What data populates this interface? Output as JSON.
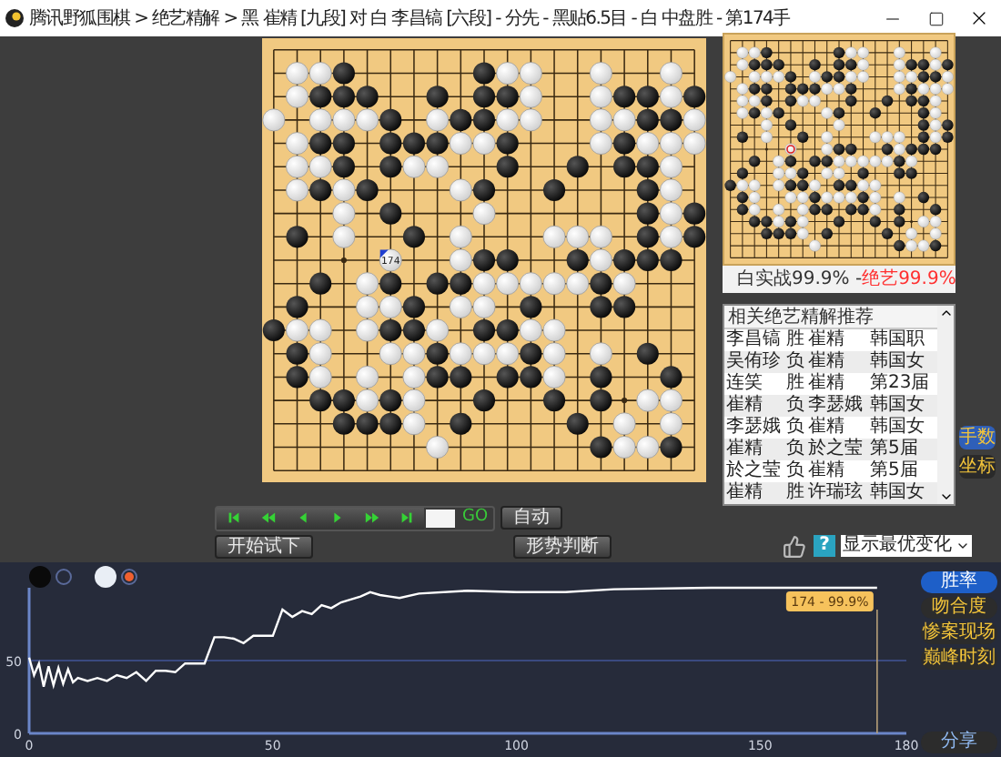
{
  "window": {
    "title": "腾讯野狐围棋 > 绝艺精解 > 黑 崔精 [九段] 对 白 李昌镐 [六段] - 分先 - 黑贴6.5目 - 白 中盘胜 - 第174手"
  },
  "board": {
    "last_move_label": "174",
    "rows": [
      [
        {
          "kind": "none"
        },
        {
          "kind": "none"
        },
        {
          "kind": "none"
        },
        {
          "kind": "none"
        },
        {
          "kind": "none"
        },
        {
          "kind": "none"
        },
        {
          "kind": "none"
        },
        {
          "kind": "none"
        },
        {
          "kind": "none"
        },
        {
          "kind": "none"
        },
        {
          "kind": "none"
        },
        {
          "kind": "none"
        },
        {
          "kind": "none"
        },
        {
          "kind": "none"
        },
        {
          "kind": "none"
        },
        {
          "kind": "none"
        },
        {
          "kind": "none"
        },
        {
          "kind": "none"
        },
        {
          "kind": "none"
        }
      ],
      [
        {
          "kind": "none"
        },
        {
          "kind": "white"
        },
        {
          "kind": "white"
        },
        {
          "kind": "black"
        },
        {
          "kind": "none"
        },
        {
          "kind": "none"
        },
        {
          "kind": "none"
        },
        {
          "kind": "none"
        },
        {
          "kind": "none"
        },
        {
          "kind": "black"
        },
        {
          "kind": "white"
        },
        {
          "kind": "white"
        },
        {
          "kind": "none"
        },
        {
          "kind": "none"
        },
        {
          "kind": "white"
        },
        {
          "kind": "none"
        },
        {
          "kind": "none"
        },
        {
          "kind": "white"
        },
        {
          "kind": "none"
        }
      ],
      [
        {
          "kind": "none"
        },
        {
          "kind": "white"
        },
        {
          "kind": "black"
        },
        {
          "kind": "black"
        },
        {
          "kind": "black"
        },
        {
          "kind": "none"
        },
        {
          "kind": "none"
        },
        {
          "kind": "black"
        },
        {
          "kind": "none"
        },
        {
          "kind": "black"
        },
        {
          "kind": "black"
        },
        {
          "kind": "white"
        },
        {
          "kind": "none"
        },
        {
          "kind": "none"
        },
        {
          "kind": "white"
        },
        {
          "kind": "black"
        },
        {
          "kind": "black"
        },
        {
          "kind": "white"
        },
        {
          "kind": "black"
        }
      ],
      [
        {
          "kind": "white"
        },
        {
          "kind": "none"
        },
        {
          "kind": "white"
        },
        {
          "kind": "white"
        },
        {
          "kind": "white"
        },
        {
          "kind": "black"
        },
        {
          "kind": "none"
        },
        {
          "kind": "white"
        },
        {
          "kind": "black"
        },
        {
          "kind": "black"
        },
        {
          "kind": "white"
        },
        {
          "kind": "white"
        },
        {
          "kind": "none"
        },
        {
          "kind": "none"
        },
        {
          "kind": "white"
        },
        {
          "kind": "white"
        },
        {
          "kind": "black"
        },
        {
          "kind": "black"
        },
        {
          "kind": "white"
        }
      ],
      [
        {
          "kind": "none"
        },
        {
          "kind": "white"
        },
        {
          "kind": "black"
        },
        {
          "kind": "black"
        },
        {
          "kind": "none"
        },
        {
          "kind": "black"
        },
        {
          "kind": "black"
        },
        {
          "kind": "black"
        },
        {
          "kind": "white"
        },
        {
          "kind": "white"
        },
        {
          "kind": "black"
        },
        {
          "kind": "none"
        },
        {
          "kind": "none"
        },
        {
          "kind": "none"
        },
        {
          "kind": "white"
        },
        {
          "kind": "black"
        },
        {
          "kind": "white"
        },
        {
          "kind": "white"
        },
        {
          "kind": "white"
        }
      ],
      [
        {
          "kind": "none"
        },
        {
          "kind": "white"
        },
        {
          "kind": "white"
        },
        {
          "kind": "black"
        },
        {
          "kind": "none"
        },
        {
          "kind": "black"
        },
        {
          "kind": "white"
        },
        {
          "kind": "white"
        },
        {
          "kind": "none"
        },
        {
          "kind": "none"
        },
        {
          "kind": "black"
        },
        {
          "kind": "none"
        },
        {
          "kind": "none"
        },
        {
          "kind": "black"
        },
        {
          "kind": "none"
        },
        {
          "kind": "black"
        },
        {
          "kind": "black"
        },
        {
          "kind": "white"
        },
        {
          "kind": "none"
        }
      ],
      [
        {
          "kind": "none"
        },
        {
          "kind": "white"
        },
        {
          "kind": "black"
        },
        {
          "kind": "white"
        },
        {
          "kind": "black"
        },
        {
          "kind": "none"
        },
        {
          "kind": "none"
        },
        {
          "kind": "none"
        },
        {
          "kind": "white"
        },
        {
          "kind": "black"
        },
        {
          "kind": "none"
        },
        {
          "kind": "none"
        },
        {
          "kind": "black"
        },
        {
          "kind": "none"
        },
        {
          "kind": "none"
        },
        {
          "kind": "none"
        },
        {
          "kind": "black"
        },
        {
          "kind": "white"
        },
        {
          "kind": "none"
        }
      ],
      [
        {
          "kind": "none"
        },
        {
          "kind": "none"
        },
        {
          "kind": "none"
        },
        {
          "kind": "white"
        },
        {
          "kind": "none"
        },
        {
          "kind": "black"
        },
        {
          "kind": "none"
        },
        {
          "kind": "none"
        },
        {
          "kind": "none"
        },
        {
          "kind": "white"
        },
        {
          "kind": "none"
        },
        {
          "kind": "none"
        },
        {
          "kind": "none"
        },
        {
          "kind": "none"
        },
        {
          "kind": "none"
        },
        {
          "kind": "none"
        },
        {
          "kind": "black"
        },
        {
          "kind": "white"
        },
        {
          "kind": "black"
        }
      ],
      [
        {
          "kind": "none"
        },
        {
          "kind": "black"
        },
        {
          "kind": "none"
        },
        {
          "kind": "white"
        },
        {
          "kind": "none"
        },
        {
          "kind": "none"
        },
        {
          "kind": "black"
        },
        {
          "kind": "none"
        },
        {
          "kind": "white"
        },
        {
          "kind": "none"
        },
        {
          "kind": "none"
        },
        {
          "kind": "none"
        },
        {
          "kind": "white"
        },
        {
          "kind": "white"
        },
        {
          "kind": "white"
        },
        {
          "kind": "none"
        },
        {
          "kind": "black"
        },
        {
          "kind": "white"
        },
        {
          "kind": "black"
        }
      ],
      [
        {
          "kind": "none"
        },
        {
          "kind": "none"
        },
        {
          "kind": "none"
        },
        {
          "kind": "none"
        },
        {
          "kind": "none"
        },
        {
          "kind": "last"
        },
        {
          "kind": "none"
        },
        {
          "kind": "none"
        },
        {
          "kind": "white"
        },
        {
          "kind": "black"
        },
        {
          "kind": "black"
        },
        {
          "kind": "none"
        },
        {
          "kind": "none"
        },
        {
          "kind": "black"
        },
        {
          "kind": "white"
        },
        {
          "kind": "black"
        },
        {
          "kind": "black"
        },
        {
          "kind": "black"
        },
        {
          "kind": "none"
        }
      ],
      [
        {
          "kind": "none"
        },
        {
          "kind": "none"
        },
        {
          "kind": "black"
        },
        {
          "kind": "none"
        },
        {
          "kind": "white"
        },
        {
          "kind": "black"
        },
        {
          "kind": "none"
        },
        {
          "kind": "black"
        },
        {
          "kind": "black"
        },
        {
          "kind": "white"
        },
        {
          "kind": "white"
        },
        {
          "kind": "white"
        },
        {
          "kind": "white"
        },
        {
          "kind": "white"
        },
        {
          "kind": "black"
        },
        {
          "kind": "white"
        },
        {
          "kind": "none"
        },
        {
          "kind": "none"
        },
        {
          "kind": "none"
        }
      ],
      [
        {
          "kind": "none"
        },
        {
          "kind": "black"
        },
        {
          "kind": "none"
        },
        {
          "kind": "none"
        },
        {
          "kind": "white"
        },
        {
          "kind": "white"
        },
        {
          "kind": "black"
        },
        {
          "kind": "none"
        },
        {
          "kind": "white"
        },
        {
          "kind": "white"
        },
        {
          "kind": "none"
        },
        {
          "kind": "black"
        },
        {
          "kind": "none"
        },
        {
          "kind": "none"
        },
        {
          "kind": "black"
        },
        {
          "kind": "black"
        },
        {
          "kind": "none"
        },
        {
          "kind": "none"
        },
        {
          "kind": "none"
        }
      ],
      [
        {
          "kind": "black"
        },
        {
          "kind": "white"
        },
        {
          "kind": "white"
        },
        {
          "kind": "none"
        },
        {
          "kind": "white"
        },
        {
          "kind": "black"
        },
        {
          "kind": "black"
        },
        {
          "kind": "white"
        },
        {
          "kind": "none"
        },
        {
          "kind": "black"
        },
        {
          "kind": "black"
        },
        {
          "kind": "white"
        },
        {
          "kind": "white"
        },
        {
          "kind": "none"
        },
        {
          "kind": "none"
        },
        {
          "kind": "none"
        },
        {
          "kind": "none"
        },
        {
          "kind": "none"
        },
        {
          "kind": "none"
        }
      ],
      [
        {
          "kind": "none"
        },
        {
          "kind": "black"
        },
        {
          "kind": "white"
        },
        {
          "kind": "none"
        },
        {
          "kind": "none"
        },
        {
          "kind": "white"
        },
        {
          "kind": "white"
        },
        {
          "kind": "black"
        },
        {
          "kind": "white"
        },
        {
          "kind": "white"
        },
        {
          "kind": "white"
        },
        {
          "kind": "black"
        },
        {
          "kind": "white"
        },
        {
          "kind": "none"
        },
        {
          "kind": "white"
        },
        {
          "kind": "none"
        },
        {
          "kind": "black"
        },
        {
          "kind": "none"
        },
        {
          "kind": "none"
        }
      ],
      [
        {
          "kind": "none"
        },
        {
          "kind": "black"
        },
        {
          "kind": "white"
        },
        {
          "kind": "none"
        },
        {
          "kind": "white"
        },
        {
          "kind": "none"
        },
        {
          "kind": "white"
        },
        {
          "kind": "black"
        },
        {
          "kind": "black"
        },
        {
          "kind": "none"
        },
        {
          "kind": "black"
        },
        {
          "kind": "black"
        },
        {
          "kind": "white"
        },
        {
          "kind": "none"
        },
        {
          "kind": "black"
        },
        {
          "kind": "none"
        },
        {
          "kind": "none"
        },
        {
          "kind": "black"
        },
        {
          "kind": "none"
        }
      ],
      [
        {
          "kind": "none"
        },
        {
          "kind": "none"
        },
        {
          "kind": "black"
        },
        {
          "kind": "black"
        },
        {
          "kind": "white"
        },
        {
          "kind": "black"
        },
        {
          "kind": "white"
        },
        {
          "kind": "none"
        },
        {
          "kind": "none"
        },
        {
          "kind": "black"
        },
        {
          "kind": "none"
        },
        {
          "kind": "none"
        },
        {
          "kind": "black"
        },
        {
          "kind": "none"
        },
        {
          "kind": "black"
        },
        {
          "kind": "none"
        },
        {
          "kind": "white"
        },
        {
          "kind": "white"
        },
        {
          "kind": "none"
        }
      ],
      [
        {
          "kind": "none"
        },
        {
          "kind": "none"
        },
        {
          "kind": "none"
        },
        {
          "kind": "black"
        },
        {
          "kind": "black"
        },
        {
          "kind": "black"
        },
        {
          "kind": "white"
        },
        {
          "kind": "none"
        },
        {
          "kind": "black"
        },
        {
          "kind": "none"
        },
        {
          "kind": "none"
        },
        {
          "kind": "none"
        },
        {
          "kind": "none"
        },
        {
          "kind": "black"
        },
        {
          "kind": "none"
        },
        {
          "kind": "white"
        },
        {
          "kind": "none"
        },
        {
          "kind": "white"
        },
        {
          "kind": "none"
        }
      ],
      [
        {
          "kind": "none"
        },
        {
          "kind": "none"
        },
        {
          "kind": "none"
        },
        {
          "kind": "none"
        },
        {
          "kind": "none"
        },
        {
          "kind": "none"
        },
        {
          "kind": "none"
        },
        {
          "kind": "white"
        },
        {
          "kind": "none"
        },
        {
          "kind": "none"
        },
        {
          "kind": "none"
        },
        {
          "kind": "none"
        },
        {
          "kind": "none"
        },
        {
          "kind": "none"
        },
        {
          "kind": "black"
        },
        {
          "kind": "white"
        },
        {
          "kind": "white"
        },
        {
          "kind": "black"
        },
        {
          "kind": "none"
        }
      ],
      [
        {
          "kind": "none"
        },
        {
          "kind": "none"
        },
        {
          "kind": "none"
        },
        {
          "kind": "none"
        },
        {
          "kind": "none"
        },
        {
          "kind": "none"
        },
        {
          "kind": "none"
        },
        {
          "kind": "none"
        },
        {
          "kind": "none"
        },
        {
          "kind": "none"
        },
        {
          "kind": "none"
        },
        {
          "kind": "none"
        },
        {
          "kind": "none"
        },
        {
          "kind": "none"
        },
        {
          "kind": "none"
        },
        {
          "kind": "none"
        },
        {
          "kind": "none"
        },
        {
          "kind": "none"
        },
        {
          "kind": "none"
        }
      ]
    ]
  },
  "score": {
    "actual": "白实战99.9% - ",
    "ai": "绝艺99.9%"
  },
  "recommend_list": {
    "header": "相关绝艺精解推荐",
    "rows": [
      {
        "player_1": "李昌镐",
        "result": "胜",
        "player_2": "崔精",
        "event": "韩国职"
      },
      {
        "player_1": "吴侑珍",
        "result": "负",
        "player_2": "崔精",
        "event": "韩国女"
      },
      {
        "player_1": "连笑",
        "result": "胜",
        "player_2": "崔精",
        "event": "第23届"
      },
      {
        "player_1": "崔精",
        "result": "负",
        "player_2": "李瑟娥",
        "event": "韩国女"
      },
      {
        "player_1": "李瑟娥",
        "result": "负",
        "player_2": "崔精",
        "event": "韩国女"
      },
      {
        "player_1": "崔精",
        "result": "负",
        "player_2": "於之莹",
        "event": "第5届"
      },
      {
        "player_1": "於之莹",
        "result": "负",
        "player_2": "崔精",
        "event": "第5届"
      },
      {
        "player_1": "崔精",
        "result": "胜",
        "player_2": "许瑞玹",
        "event": "韩国女"
      }
    ]
  },
  "side_buttons": [
    {
      "label": "手数",
      "selected": true
    },
    {
      "label": "坐标",
      "selected": false
    }
  ],
  "nav_buttons": [
    {
      "kind": "first"
    },
    {
      "kind": "back_many"
    },
    {
      "kind": "back"
    },
    {
      "kind": "forward"
    },
    {
      "kind": "forward_many"
    },
    {
      "kind": "last"
    }
  ],
  "go_button": "GO",
  "auto_button": "自动",
  "try_button": "开始试下",
  "judge_button": "形势判断",
  "help_button": "?",
  "variation_select": {
    "value": "显示最优变化"
  },
  "analysis": {
    "chart_data": {
      "type": "line",
      "xlim": [
        0,
        180
      ],
      "ylim": [
        0,
        100
      ],
      "xticks": [
        0,
        50,
        100,
        150,
        180
      ],
      "yticks": [
        0,
        50
      ],
      "x": [
        0,
        1,
        2,
        3,
        4,
        5,
        6,
        7,
        8,
        9,
        10,
        12,
        14,
        16,
        18,
        20,
        22,
        24,
        26,
        28,
        30,
        32,
        34,
        36,
        38,
        40,
        42,
        44,
        46,
        48,
        50,
        52,
        54,
        56,
        58,
        60,
        62,
        64,
        66,
        68,
        70,
        72,
        74,
        76,
        80,
        90,
        100,
        110,
        120,
        140,
        160,
        174
      ],
      "series": [
        {
          "color": "#ffffff",
          "values": [
            52,
            40,
            48,
            32,
            46,
            33,
            45,
            34,
            44,
            35,
            38,
            36,
            38,
            36,
            40,
            38,
            42,
            36,
            43,
            43,
            42,
            48,
            48,
            48,
            66,
            66,
            65,
            62,
            67,
            67,
            67,
            85,
            80,
            84,
            82,
            88,
            86,
            90,
            92,
            94,
            97,
            95,
            94,
            93,
            96,
            98,
            97,
            97,
            99,
            100,
            100,
            100
          ]
        }
      ],
      "ref_lines": [
        {
          "axis": "y",
          "value": 50
        },
        {
          "axis": "x",
          "value": 174
        }
      ],
      "annotations": [
        "174 - 99.9%"
      ]
    },
    "buttons": [
      {
        "label": "胜率",
        "selected": true
      },
      {
        "label": "吻合度",
        "selected": false
      },
      {
        "label": "惨案现场",
        "selected": false
      },
      {
        "label": "巅峰时刻",
        "selected": false
      }
    ],
    "share_button": "分享"
  }
}
